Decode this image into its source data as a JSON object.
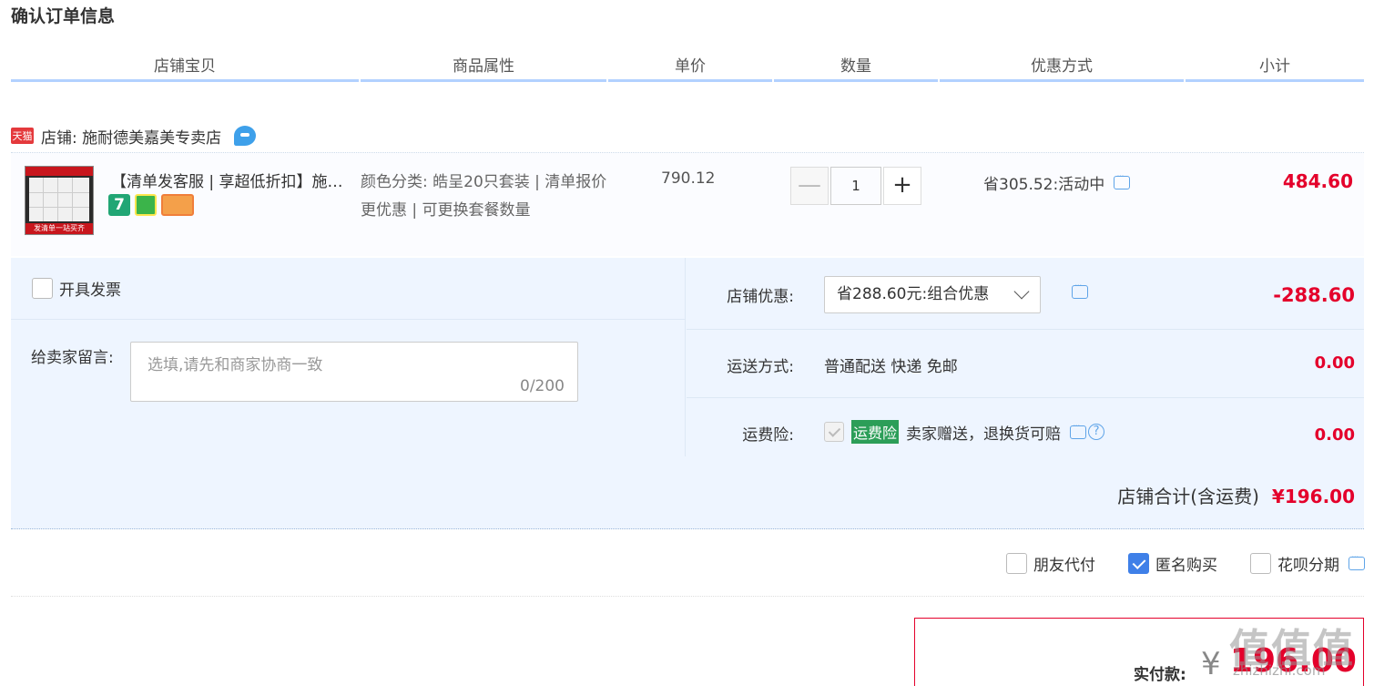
{
  "page": {
    "title": "确认订单信息"
  },
  "columns": [
    "店铺宝贝",
    "商品属性",
    "单价",
    "数量",
    "优惠方式",
    "小计"
  ],
  "shop": {
    "badge": "天猫",
    "label": "店铺: 施耐德美嘉美专卖店"
  },
  "item": {
    "thumb_band": "发清单一站买齐",
    "title": "【清单发客服 | 享超低折扣】施耐德开关插座面板",
    "service_badge_7": "7",
    "attributes": "颜色分类: 皓呈20只套装 | 清单报价更优惠 | 可更换套餐数量",
    "unit_price": "790.12",
    "quantity": "1",
    "minus": "—",
    "plus": "+",
    "promo": "省305.52:活动中",
    "subtotal": "484.60"
  },
  "invoice": {
    "label": "开具发票",
    "checked": false
  },
  "message": {
    "label": "给卖家留言:",
    "placeholder": "选填,请先和商家协商一致",
    "counter": "0/200"
  },
  "store_discount": {
    "label": "店铺优惠:",
    "selected": "省288.60元:组合优惠",
    "amount": "-288.60"
  },
  "shipping": {
    "label": "运送方式:",
    "value": "普通配送 快递 免邮",
    "amount": "0.00"
  },
  "insurance": {
    "label": "运费险:",
    "tag": "运费险",
    "text": "卖家赠送，退换货可赔",
    "help": "?",
    "amount": "0.00"
  },
  "store_total": {
    "label": "店铺合计(含运费)",
    "amount": "¥196.00"
  },
  "options": [
    {
      "label": "朋友代付",
      "checked": false
    },
    {
      "label": "匿名购买",
      "checked": true
    },
    {
      "label": "花呗分期",
      "checked": false
    }
  ],
  "payment": {
    "label": "实付款:",
    "currency": "¥",
    "amount": "196.00"
  },
  "watermark": {
    "text": "值值值",
    "url": "zhizhizhi.com"
  },
  "colors": {
    "accent_red": "#e4002b",
    "header_rule": "#b2d1ff",
    "panel_bg": "#eef5ff",
    "check_blue": "#3f80e8"
  }
}
